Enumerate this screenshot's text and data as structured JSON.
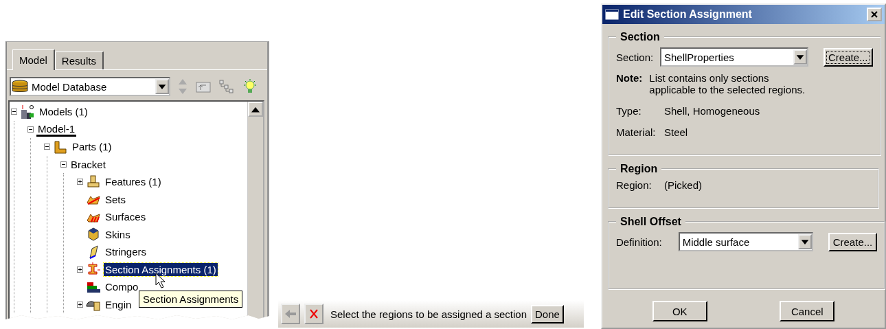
{
  "tree_panel": {
    "tabs": [
      {
        "label": "Model",
        "selected": true
      },
      {
        "label": "Results",
        "selected": false
      }
    ],
    "database_select": {
      "value": "Model Database"
    },
    "tree": [
      {
        "label": "Models (1)",
        "kind": "models",
        "expanded": true,
        "selected": false,
        "current": false,
        "children": [
          {
            "label": "Model-1",
            "expanded": true,
            "selected": false,
            "current": true,
            "children": [
              {
                "label": "Parts (1)",
                "kind": "parts",
                "expanded": true,
                "selected": false,
                "current": false,
                "children": [
                  {
                    "label": "Bracket",
                    "expanded": true,
                    "selected": false,
                    "current": false,
                    "children": [
                      {
                        "label": "Features (1)",
                        "kind": "features",
                        "expanded": false,
                        "selected": false,
                        "current": false
                      },
                      {
                        "label": "Sets",
                        "kind": "sets",
                        "selected": false,
                        "current": false
                      },
                      {
                        "label": "Surfaces",
                        "kind": "surfaces",
                        "selected": false,
                        "current": false
                      },
                      {
                        "label": "Skins",
                        "kind": "skins",
                        "selected": false,
                        "current": false
                      },
                      {
                        "label": "Stringers",
                        "kind": "stringers",
                        "selected": false,
                        "current": false
                      },
                      {
                        "label": "Section Assignments (1)",
                        "kind": "sections",
                        "expanded": false,
                        "selected": true,
                        "current": false
                      },
                      {
                        "label": "Compo",
                        "kind": "layups",
                        "selected": false,
                        "current": false
                      },
                      {
                        "label": "Engin",
                        "kind": "engineering",
                        "expanded": false,
                        "selected": false,
                        "current": false
                      }
                    ]
                  }
                ]
              }
            ]
          }
        ]
      }
    ],
    "tooltip": "Section Assignments"
  },
  "prompt_bar": {
    "text": "Select the regions to be assigned a section",
    "button": "Done"
  },
  "dialog": {
    "title": "Edit Section Assignment",
    "groups": [
      {
        "title": "Section",
        "rows": [
          {
            "kind": "combo",
            "label": "Section:",
            "value": "ShellProperties",
            "button": "Create...",
            "focused": true
          },
          {
            "kind": "note",
            "label": "Note:",
            "text": "List contains only sections applicable to the selected regions."
          },
          {
            "kind": "info",
            "label": "Type:",
            "value": "Shell, Homogeneous"
          },
          {
            "kind": "info",
            "label": "Material:",
            "value": "Steel"
          }
        ]
      },
      {
        "title": "Region",
        "rows": [
          {
            "kind": "info",
            "label": "Region:",
            "value": "(Picked)"
          }
        ]
      },
      {
        "title": "Shell Offset",
        "rows": [
          {
            "kind": "combo",
            "label": "Definition:",
            "value": "Middle surface",
            "button": "Create...",
            "focused": false
          }
        ]
      }
    ],
    "buttons": [
      "OK",
      "Cancel"
    ]
  }
}
